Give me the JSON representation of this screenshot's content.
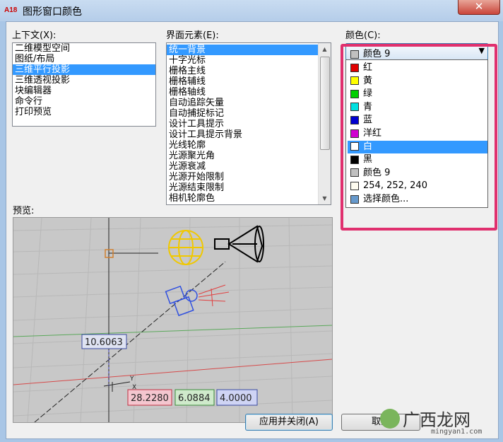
{
  "window": {
    "title": "图形窗口颜色",
    "app_icon_text": "A18",
    "close_symbol": "✕"
  },
  "context": {
    "label": "上下文(X):",
    "items": [
      "二维模型空间",
      "图纸/布局",
      "三维平行投影",
      "三维透视投影",
      "块编辑器",
      "命令行",
      "打印预览"
    ],
    "selected_index": 2
  },
  "interface_elements": {
    "label": "界面元素(E):",
    "items": [
      "统一背景",
      "十字光标",
      "栅格主线",
      "栅格辅线",
      "栅格轴线",
      "自动追踪矢量",
      "自动捕捉标记",
      "设计工具提示",
      "设计工具提示背景",
      "光线轮廓",
      "光源聚光角",
      "光源衰减",
      "光源开始限制",
      "光源结束限制",
      "相机轮廓色"
    ],
    "selected_index": 0
  },
  "color": {
    "label": "颜色(C):",
    "combo_value": "颜色 9",
    "combo_swatch": "#c0c0c0",
    "options": [
      {
        "label": "红",
        "swatch": "#e00000"
      },
      {
        "label": "黄",
        "swatch": "#ffff00"
      },
      {
        "label": "绿",
        "swatch": "#00d000"
      },
      {
        "label": "青",
        "swatch": "#00e0e0"
      },
      {
        "label": "蓝",
        "swatch": "#0000d0"
      },
      {
        "label": "洋红",
        "swatch": "#d000d0"
      },
      {
        "label": "白",
        "swatch": "#ffffff"
      },
      {
        "label": "黑",
        "swatch": "#000000"
      },
      {
        "label": "颜色 9",
        "swatch": "#c0c0c0"
      },
      {
        "label": "254, 252, 240",
        "swatch": "#fefcf0"
      },
      {
        "label": "选择颜色...",
        "swatch": "#6699cc"
      }
    ],
    "selected_index": 6,
    "highlight_color": "#e0306e"
  },
  "preview": {
    "label": "预览:",
    "dimension_value": "10.6063",
    "coord_x": "28.2280",
    "coord_y": "6.0884",
    "coord_z": "4.0000",
    "axis_labels": {
      "x": "X",
      "y": "Y"
    }
  },
  "buttons": {
    "apply_close": "应用并关闭(A)",
    "cancel": "取消"
  },
  "watermark": {
    "brand": "广西龙网",
    "site": "mingyan1.com"
  }
}
